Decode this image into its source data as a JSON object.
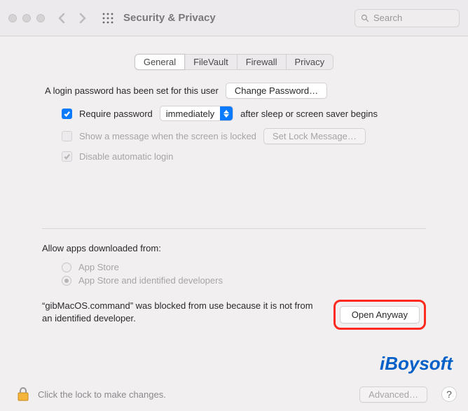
{
  "window": {
    "title": "Security & Privacy",
    "search_placeholder": "Search"
  },
  "tabs": [
    {
      "label": "General",
      "active": true
    },
    {
      "label": "FileVault",
      "active": false
    },
    {
      "label": "Firewall",
      "active": false
    },
    {
      "label": "Privacy",
      "active": false
    }
  ],
  "login": {
    "password_set_label": "A login password has been set for this user",
    "change_password_label": "Change Password…",
    "require_password_label": "Require password",
    "require_password_checked": true,
    "delay_value": "immediately",
    "after_sleep_label": "after sleep or screen saver begins",
    "show_message_label": "Show a message when the screen is locked",
    "show_message_checked": false,
    "set_lock_message_label": "Set Lock Message…",
    "disable_auto_login_label": "Disable automatic login",
    "disable_auto_login_checked": true
  },
  "allow_apps": {
    "section_label": "Allow apps downloaded from:",
    "options": [
      {
        "label": "App Store",
        "selected": false
      },
      {
        "label": "App Store and identified developers",
        "selected": true
      }
    ],
    "blocked_message": "“gibMacOS.command” was blocked from use because it is not from an identified developer.",
    "open_anyway_label": "Open Anyway"
  },
  "footer": {
    "lock_hint": "Click the lock to make changes.",
    "advanced_label": "Advanced…",
    "help_label": "?"
  },
  "watermark": "iBoysoft"
}
